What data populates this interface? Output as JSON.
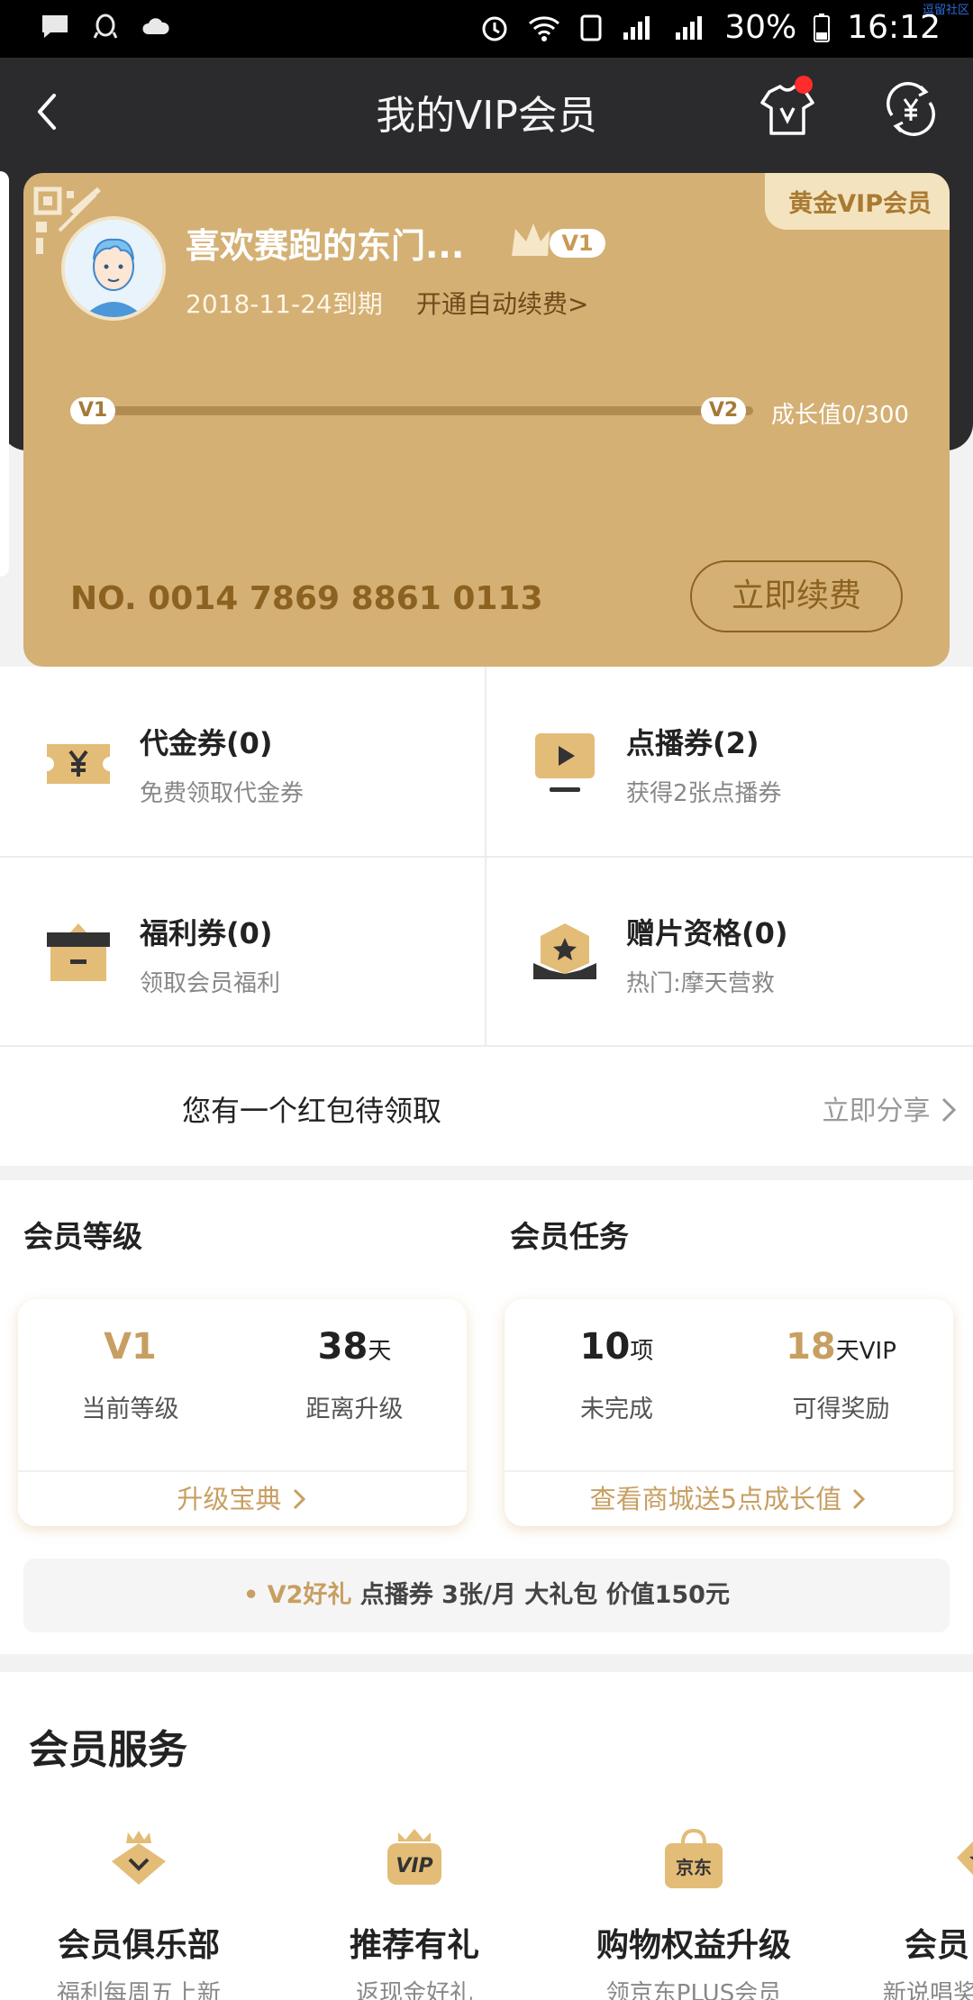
{
  "status_bar": {
    "battery": "30%",
    "time": "16:12",
    "watermark": "逗留社区"
  },
  "header": {
    "title": "我的VIP会员"
  },
  "vip_card": {
    "tag": "黄金VIP会员",
    "username": "喜欢赛跑的东门...",
    "level_badge": "V1",
    "expire": "2018-11-24到期",
    "autorenew": "开通自动续费>",
    "level_from": "V1",
    "level_to": "V2",
    "growth": "成长值0/300",
    "growth_progress": 0,
    "card_no": "NO. 0014 7869 8861 0113",
    "renew_button": "立即续费"
  },
  "coupons": [
    {
      "title": "代金券(0)",
      "subtitle": "免费领取代金券",
      "icon": "yen-ticket-icon"
    },
    {
      "title": "点播券(2)",
      "subtitle": "获得2张点播券",
      "icon": "play-screen-icon"
    },
    {
      "title": "福利券(0)",
      "subtitle": "领取会员福利",
      "icon": "gift-box-icon"
    },
    {
      "title": "赠片资格(0)",
      "subtitle": "热门:摩天营救",
      "icon": "star-badge-icon"
    }
  ],
  "red_packet": {
    "text": "您有一个红包待领取",
    "share": "立即分享"
  },
  "member_level": {
    "title": "会员等级",
    "current_value": "V1",
    "current_label": "当前等级",
    "days_value": "38",
    "days_unit": "天",
    "days_label": "距离升级",
    "footer": "升级宝典"
  },
  "member_task": {
    "title": "会员任务",
    "pending_value": "10",
    "pending_unit": "项",
    "pending_label": "未完成",
    "reward_value": "18",
    "reward_unit": "天VIP",
    "reward_label": "可得奖励",
    "footer": "查看商城送5点成长值"
  },
  "gift_bar": {
    "prefix": "• V2好礼",
    "text": "点播券 3张/月  大礼包 价值150元"
  },
  "services": {
    "title": "会员服务",
    "items": [
      {
        "name": "会员俱乐部",
        "subtitle": "福利每周五上新",
        "icon": "crown-shield-icon"
      },
      {
        "name": "推荐有礼",
        "subtitle": "返现金好礼",
        "icon": "vip-crown-icon"
      },
      {
        "name": "购物权益升级",
        "subtitle": "领京东PLUS会员",
        "icon": "jd-bag-icon",
        "icon_text": "京东"
      },
      {
        "name": "会员",
        "subtitle": "新说唱奖",
        "icon": "star-crown-icon"
      }
    ]
  }
}
